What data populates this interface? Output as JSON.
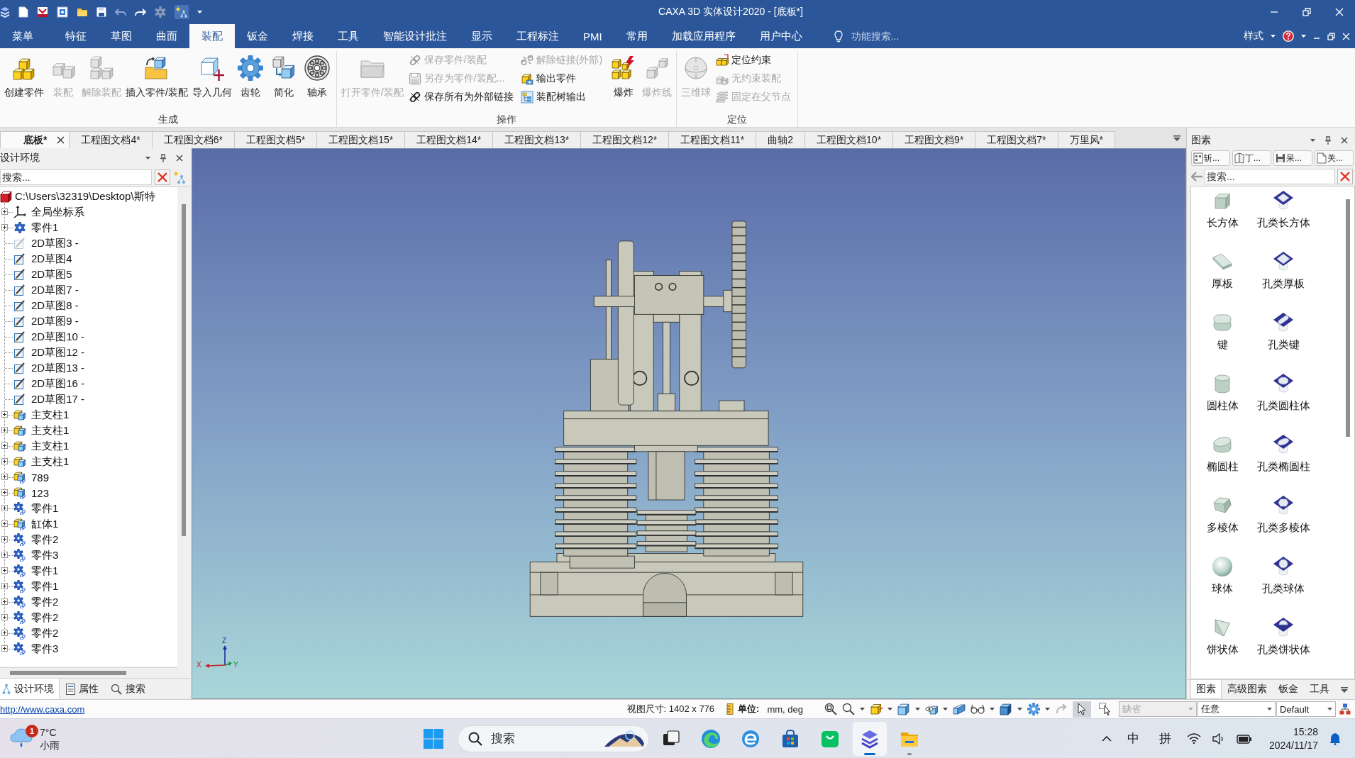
{
  "title_bar": {
    "title": "CAXA 3D 实体设计2020 - [底板*]"
  },
  "menu_tabs": [
    {
      "label": "菜单",
      "selected": false
    },
    {
      "label": "特征",
      "selected": false
    },
    {
      "label": "草图",
      "selected": false
    },
    {
      "label": "曲面",
      "selected": false
    },
    {
      "label": "装配",
      "selected": true
    },
    {
      "label": "钣金",
      "selected": false
    },
    {
      "label": "焊接",
      "selected": false
    },
    {
      "label": "工具",
      "selected": false
    },
    {
      "label": "智能设计批注",
      "selected": false
    },
    {
      "label": "显示",
      "selected": false
    },
    {
      "label": "工程标注",
      "selected": false
    },
    {
      "label": "PMI",
      "selected": false
    },
    {
      "label": "常用",
      "selected": false
    },
    {
      "label": "加载应用程序",
      "selected": false
    },
    {
      "label": "用户中心",
      "selected": false
    }
  ],
  "feature_search": {
    "placeholder": "功能搜索..."
  },
  "style_menu": {
    "label": "样式"
  },
  "ribbon_groups": [
    {
      "title": "生成",
      "items": [
        {
          "kind": "large",
          "label": "创建零件",
          "disabled": false
        },
        {
          "kind": "large",
          "label": "装配",
          "disabled": true
        },
        {
          "kind": "large",
          "label": "解除装配",
          "disabled": true
        },
        {
          "kind": "large",
          "label": "插入零件/装配",
          "disabled": false
        },
        {
          "kind": "large",
          "label": "导入几何",
          "disabled": false
        },
        {
          "kind": "large",
          "label": "齿轮",
          "disabled": false
        },
        {
          "kind": "large",
          "label": "简化",
          "disabled": false
        },
        {
          "kind": "large",
          "label": "轴承",
          "disabled": false
        }
      ]
    },
    {
      "title": "操作",
      "items": [
        {
          "kind": "large",
          "label": "打开零件/装配",
          "disabled": true
        },
        {
          "kind": "small",
          "label": "保存零件/装配",
          "disabled": true
        },
        {
          "kind": "small",
          "label": "另存为零件/装配...",
          "disabled": true
        },
        {
          "kind": "small",
          "label": "保存所有为外部链接",
          "disabled": false
        },
        {
          "kind": "small",
          "label": "解除链接(外部)",
          "disabled": true
        },
        {
          "kind": "small",
          "label": "输出零件",
          "disabled": false
        },
        {
          "kind": "small",
          "label": "装配树输出",
          "disabled": false
        },
        {
          "kind": "large",
          "label": "爆炸",
          "disabled": false
        },
        {
          "kind": "large",
          "label": "爆炸线",
          "disabled": true
        }
      ]
    },
    {
      "title": "定位",
      "items": [
        {
          "kind": "large",
          "label": "三维球",
          "disabled": true
        },
        {
          "kind": "small",
          "label": "定位约束",
          "disabled": false
        },
        {
          "kind": "small",
          "label": "无约束装配",
          "disabled": true
        },
        {
          "kind": "small",
          "label": "固定在父节点",
          "disabled": true
        }
      ]
    }
  ],
  "doc_tabs": [
    {
      "label": "底板*",
      "selected": true
    },
    {
      "label": "工程图文档4*",
      "selected": false
    },
    {
      "label": "工程图文档6*",
      "selected": false
    },
    {
      "label": "工程图文档5*",
      "selected": false
    },
    {
      "label": "工程图文档15*",
      "selected": false
    },
    {
      "label": "工程图文档14*",
      "selected": false
    },
    {
      "label": "工程图文档13*",
      "selected": false
    },
    {
      "label": "工程图文档12*",
      "selected": false
    },
    {
      "label": "工程图文档11*",
      "selected": false
    },
    {
      "label": "曲轴2",
      "selected": false
    },
    {
      "label": "工程图文档10*",
      "selected": false
    },
    {
      "label": "工程图文档9*",
      "selected": false
    },
    {
      "label": "工程图文档7*",
      "selected": false
    },
    {
      "label": "万里风*",
      "selected": false
    }
  ],
  "design_panel": {
    "title": "设计环境",
    "search": {
      "placeholder": "搜索..."
    },
    "tree": {
      "label": "C:\\Users\\32319\\Desktop\\斯特",
      "children": [
        {
          "label": "全局坐标系",
          "kind": "coords",
          "expanded": false,
          "greyed": false
        },
        {
          "label": "零件1",
          "kind": "part",
          "expanded": false,
          "greyed": false
        },
        {
          "label": "2D草图3 -",
          "kind": "sketch",
          "greyed": true
        },
        {
          "label": "2D草图4",
          "kind": "sketch",
          "greyed": false
        },
        {
          "label": "2D草图5",
          "kind": "sketch",
          "greyed": false
        },
        {
          "label": "2D草图7 -",
          "kind": "sketch",
          "greyed": false
        },
        {
          "label": "2D草图8 -",
          "kind": "sketch",
          "greyed": false
        },
        {
          "label": "2D草图9 -",
          "kind": "sketch",
          "greyed": false
        },
        {
          "label": "2D草图10 -",
          "kind": "sketch",
          "greyed": false
        },
        {
          "label": "2D草图12 -",
          "kind": "sketch",
          "greyed": false
        },
        {
          "label": "2D草图13 -",
          "kind": "sketch",
          "greyed": false
        },
        {
          "label": "2D草图16 -",
          "kind": "sketch",
          "greyed": false
        },
        {
          "label": "2D草图17 -",
          "kind": "sketch",
          "greyed": false
        },
        {
          "label": "主支柱1",
          "kind": "assembly",
          "expanded": false,
          "greyed": false
        },
        {
          "label": "主支柱1",
          "kind": "assembly",
          "expanded": false,
          "greyed": false
        },
        {
          "label": "主支柱1",
          "kind": "assembly",
          "expanded": false,
          "greyed": false
        },
        {
          "label": "主支柱1",
          "kind": "assembly",
          "expanded": false,
          "greyed": false
        },
        {
          "label": "789",
          "kind": "linked_assembly",
          "expanded": false,
          "greyed": false
        },
        {
          "label": "123",
          "kind": "linked_assembly",
          "expanded": false,
          "greyed": false
        },
        {
          "label": "零件1",
          "kind": "linked_part",
          "expanded": false,
          "greyed": false
        },
        {
          "label": "缸体1",
          "kind": "linked_assembly",
          "expanded": false,
          "greyed": false
        },
        {
          "label": "零件2",
          "kind": "linked_part",
          "expanded": false,
          "greyed": false
        },
        {
          "label": "零件3",
          "kind": "linked_part",
          "expanded": false,
          "greyed": false
        },
        {
          "label": "零件1",
          "kind": "linked_part",
          "expanded": false,
          "greyed": false
        },
        {
          "label": "零件1",
          "kind": "linked_part",
          "expanded": false,
          "greyed": false
        },
        {
          "label": "零件2",
          "kind": "linked_part",
          "expanded": false,
          "greyed": false
        },
        {
          "label": "零件2",
          "kind": "linked_part",
          "expanded": false,
          "greyed": false
        },
        {
          "label": "零件2",
          "kind": "linked_part",
          "expanded": false,
          "greyed": false
        },
        {
          "label": "零件3",
          "kind": "linked_part",
          "expanded": false,
          "greyed": false
        }
      ]
    },
    "tabs": [
      {
        "label": "设计环境",
        "selected": true
      },
      {
        "label": "属性",
        "selected": false
      },
      {
        "label": "搜索",
        "selected": false
      }
    ]
  },
  "viewport": {
    "axes": [
      {
        "label": "Z"
      },
      {
        "label": "X"
      },
      {
        "label": "Y"
      }
    ]
  },
  "primitives_panel": {
    "title": "图素",
    "tool_buttons": [
      {
        "label": "斩..."
      },
      {
        "label": "丁..."
      },
      {
        "label": "呆..."
      },
      {
        "label": "关..."
      }
    ],
    "search": {
      "placeholder": "搜索..."
    },
    "items": [
      {
        "label": "长方体",
        "kind": "solid"
      },
      {
        "label": "孔类长方体",
        "kind": "hole"
      },
      {
        "label": "厚板",
        "kind": "solid"
      },
      {
        "label": "孔类厚板",
        "kind": "hole"
      },
      {
        "label": "键",
        "kind": "solid"
      },
      {
        "label": "孔类键",
        "kind": "hole"
      },
      {
        "label": "圆柱体",
        "kind": "solid"
      },
      {
        "label": "孔类圆柱体",
        "kind": "hole"
      },
      {
        "label": "椭圆柱",
        "kind": "solid"
      },
      {
        "label": "孔类椭圆柱",
        "kind": "hole"
      },
      {
        "label": "多棱体",
        "kind": "solid"
      },
      {
        "label": "孔类多棱体",
        "kind": "hole"
      },
      {
        "label": "球体",
        "kind": "solid"
      },
      {
        "label": "孔类球体",
        "kind": "hole"
      },
      {
        "label": "饼状体",
        "kind": "solid"
      },
      {
        "label": "孔类饼状体",
        "kind": "hole"
      }
    ],
    "tabs": [
      {
        "label": "图素",
        "selected": true
      },
      {
        "label": "高级图素",
        "selected": false
      },
      {
        "label": "钣金",
        "selected": false
      },
      {
        "label": "工具",
        "selected": false
      }
    ]
  },
  "status_bar": {
    "link": "http://www.caxa.com",
    "view_size": "视图尺寸: 1402 x 776",
    "unit_label": "单位:",
    "unit_value": "mm, deg",
    "select_modes": [
      {
        "selected": true
      },
      {
        "selected": false
      }
    ],
    "selects": [
      {
        "value": "缺省",
        "disabled": true
      },
      {
        "value": "任意",
        "disabled": false
      },
      {
        "value": "Default",
        "disabled": false
      }
    ]
  },
  "taskbar": {
    "weather": {
      "badge": "1",
      "temperature": "7°C",
      "condition": "小雨"
    },
    "search": {
      "placeholder": "搜索"
    },
    "apps": [
      {
        "selected": false,
        "running": false
      },
      {
        "selected": false,
        "running": false
      },
      {
        "selected": false,
        "running": false
      },
      {
        "selected": false,
        "running": false
      },
      {
        "selected": false,
        "running": false
      },
      {
        "selected": true,
        "running": true
      },
      {
        "selected": false,
        "running": true
      }
    ],
    "tray": {
      "input_mode": "中",
      "input_method": "拼",
      "time": "15:28",
      "date": "2024/11/17"
    }
  }
}
